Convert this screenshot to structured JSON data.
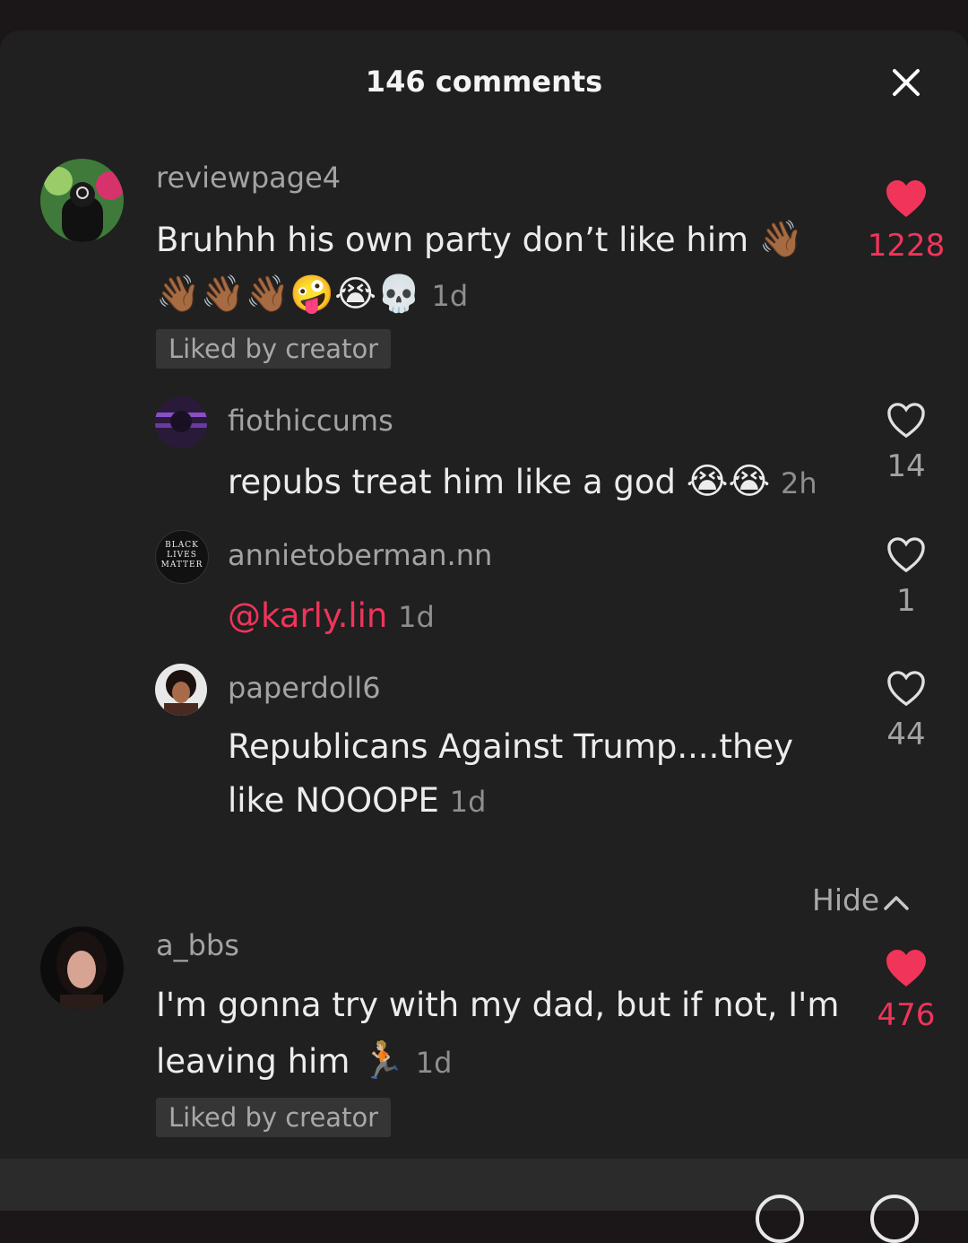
{
  "header": {
    "title": "146 comments",
    "close_icon": "close-icon"
  },
  "comments": [
    {
      "username": "reviewpage4",
      "text": "Bruhhh his own party don’t like him",
      "emoji_line1": "👋🏾",
      "emoji_line2": "👋🏾👋🏾👋🏾🤪😭💀",
      "timestamp": "1d",
      "badge": "Liked by creator",
      "likes": "1228",
      "liked": true
    },
    {
      "username": "a_bbs",
      "text_line1": "I'm gonna try with my dad, but if not, I'm",
      "text_line2": "leaving him",
      "emoji": "🏃🏼",
      "timestamp": "1d",
      "badge": "Liked by creator",
      "likes": "476",
      "liked": true
    }
  ],
  "replies": [
    {
      "username": "fiothiccums",
      "text": "repubs treat him like a god",
      "emoji": "😭😭",
      "timestamp": "2h",
      "likes": "14",
      "liked": false
    },
    {
      "username": "annietoberman.nn",
      "mention": "@karly.lin",
      "timestamp": "1d",
      "likes": "1",
      "liked": false,
      "avatar_text": [
        "BLACK",
        "LIVES",
        "MATTER"
      ]
    },
    {
      "username": "paperdoll6",
      "text_line1": "Republicans Against Trump....they",
      "text_line2": "like NOOOPE",
      "timestamp": "1d",
      "likes": "44",
      "liked": false
    }
  ],
  "hide_label": "Hide",
  "colors": {
    "accent": "#f0345a",
    "background": "#202020",
    "badge_bg": "#353535"
  }
}
